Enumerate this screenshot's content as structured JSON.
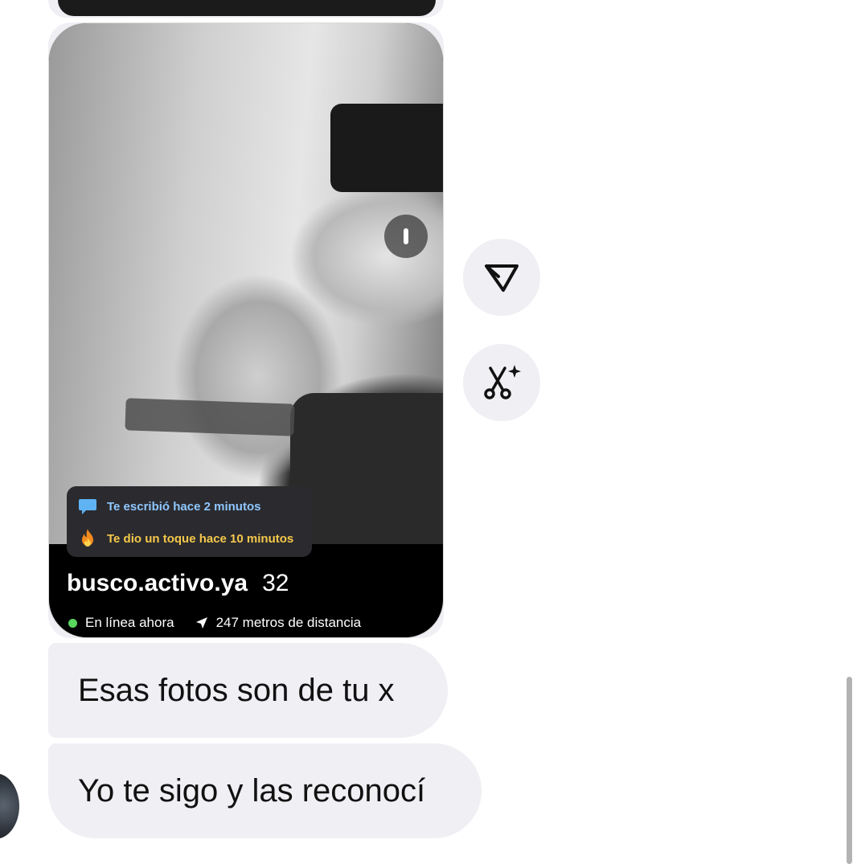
{
  "shared_card": {
    "activity": {
      "wrote": "Te escribió hace 2 minutos",
      "tapped": "Te dio un toque hace 10 minutos"
    },
    "profile": {
      "username": "busco.activo.ya",
      "age": "32",
      "status": "En línea ahora",
      "distance": "247 metros de distancia"
    }
  },
  "actions": {
    "share_icon": "send-triangle-icon",
    "cut_icon": "scissors-sparkle-icon"
  },
  "messages": [
    {
      "text": "Esas fotos son de tu x"
    },
    {
      "text": "Yo te sigo y las reconocí"
    }
  ],
  "colors": {
    "bubble_bg": "#efeff4",
    "online": "#58d65e",
    "activity_blue": "#8fc7ff",
    "activity_yellow": "#f5c84b"
  }
}
